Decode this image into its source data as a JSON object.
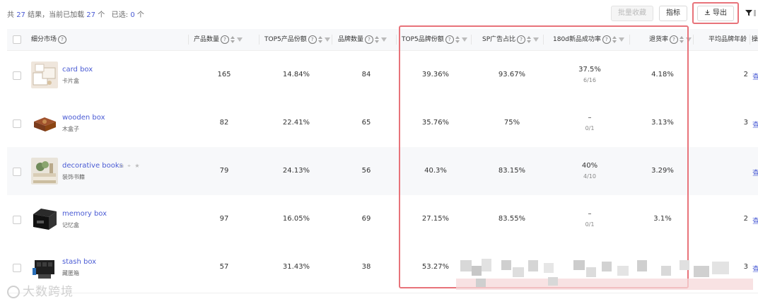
{
  "summary": {
    "prefix": "共",
    "total": "27",
    "middle": "结果，当前已加载",
    "loaded": "27",
    "unit": "个",
    "selected_label": "已选:",
    "selected": "0",
    "selected_unit": "个"
  },
  "toolbar": {
    "batch_label": "批量收藏",
    "metric_label": "指标",
    "export_label": "导出"
  },
  "columns": [
    {
      "key": "market",
      "label": "细分市场"
    },
    {
      "key": "product_count",
      "label": "产品数量"
    },
    {
      "key": "top5_product_share",
      "label": "TOP5产品份额"
    },
    {
      "key": "brand_count",
      "label": "品牌数量"
    },
    {
      "key": "top5_brand_share",
      "label": "TOP5品牌份额"
    },
    {
      "key": "sp_ad_ratio",
      "label": "SP广告占比"
    },
    {
      "key": "new_success_180d",
      "label": "180d新品成功率"
    },
    {
      "key": "return_rate",
      "label": "退货率"
    },
    {
      "key": "avg_brand_age",
      "label": "平均品牌年龄"
    },
    {
      "key": "action",
      "label": "操"
    }
  ],
  "rows": [
    {
      "name": "card box",
      "sub": "卡片盒",
      "product_count": "165",
      "top5_product_share": "14.84%",
      "brand_count": "84",
      "top5_brand_share": "39.36%",
      "sp_ad_ratio": "93.67%",
      "success_rate": "37.5%",
      "success_detail": "6/16",
      "return_rate": "4.18%",
      "age_frag": "2",
      "action_frag": "查"
    },
    {
      "name": "wooden box",
      "sub": "木盒子",
      "product_count": "82",
      "top5_product_share": "22.41%",
      "brand_count": "65",
      "top5_brand_share": "35.76%",
      "sp_ad_ratio": "75%",
      "success_rate": "–",
      "success_detail": "0/1",
      "return_rate": "3.13%",
      "age_frag": "3",
      "action_frag": "查"
    },
    {
      "name": "decorative books",
      "sub": "装饰书籍",
      "product_count": "79",
      "top5_product_share": "24.13%",
      "brand_count": "56",
      "top5_brand_share": "40.3%",
      "sp_ad_ratio": "83.15%",
      "success_rate": "40%",
      "success_detail": "4/10",
      "return_rate": "3.29%",
      "age_frag": "",
      "action_frag": "查"
    },
    {
      "name": "memory box",
      "sub": "记忆盒",
      "product_count": "97",
      "top5_product_share": "16.05%",
      "brand_count": "69",
      "top5_brand_share": "27.15%",
      "sp_ad_ratio": "83.55%",
      "success_rate": "–",
      "success_detail": "0/1",
      "return_rate": "3.1%",
      "age_frag": "2",
      "action_frag": "查"
    },
    {
      "name": "stash box",
      "sub": "藏匿箱",
      "product_count": "57",
      "top5_product_share": "31.43%",
      "brand_count": "38",
      "top5_brand_share": "53.27%",
      "sp_ad_ratio": "",
      "success_rate": "",
      "success_detail": "",
      "return_rate": "",
      "age_frag": "3",
      "action_frag": "查"
    }
  ],
  "row_actions": {
    "copy_icon": "copy-icon",
    "pin_icon": "pin-icon",
    "star_icon": "star-icon"
  },
  "watermark": "大数跨境",
  "colors": {
    "link": "#4a5bd4",
    "highlight": "#e8737a",
    "header_bg": "#f7f8fa"
  }
}
